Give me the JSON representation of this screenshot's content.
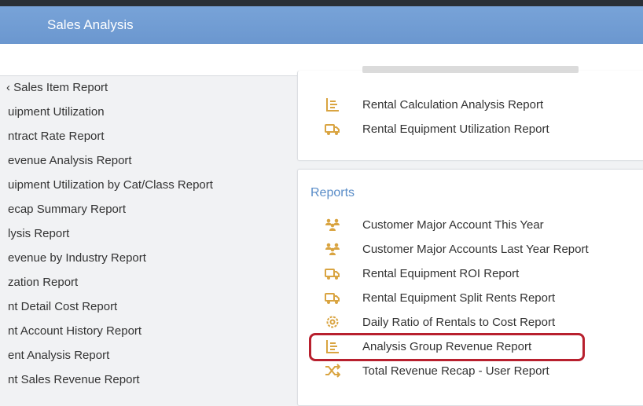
{
  "header": {
    "title": "Sales Analysis"
  },
  "left_list": [
    "‹ Sales Item Report",
    "uipment Utilization",
    "ntract Rate Report",
    "evenue Analysis Report",
    "uipment Utilization by Cat/Class Report",
    "ecap Summary Report",
    "lysis Report",
    "evenue by Industry Report",
    "zation Report",
    "nt Detail Cost Report",
    "nt Account History Report",
    "ent Analysis Report",
    "nt Sales Revenue Report"
  ],
  "top_panel": {
    "items": [
      {
        "label": "Rental Calculation Analysis Report",
        "icon": "bar-list-icon"
      },
      {
        "label": "Rental Equipment Utilization Report",
        "icon": "truck-icon"
      }
    ]
  },
  "reports_panel": {
    "title": "Reports",
    "items": [
      {
        "label": "Customer Major Account This Year",
        "icon": "users-icon"
      },
      {
        "label": "Customer Major Accounts Last Year Report",
        "icon": "users-icon"
      },
      {
        "label": "Rental Equipment ROI Report",
        "icon": "truck-icon"
      },
      {
        "label": "Rental Equipment Split Rents Report",
        "icon": "truck-icon"
      },
      {
        "label": "Daily Ratio of Rentals to Cost Report",
        "icon": "gear-icon"
      },
      {
        "label": "Analysis Group Revenue Report",
        "icon": "bar-list-icon"
      },
      {
        "label": "Total Revenue Recap - User Report",
        "icon": "shuffle-icon"
      }
    ],
    "highlighted_item": "Analysis Group Revenue Report"
  },
  "colors": {
    "header": "#6b97cf",
    "icon": "#d9a441",
    "section_title": "#5a8dc8",
    "highlight": "#b8202e"
  }
}
